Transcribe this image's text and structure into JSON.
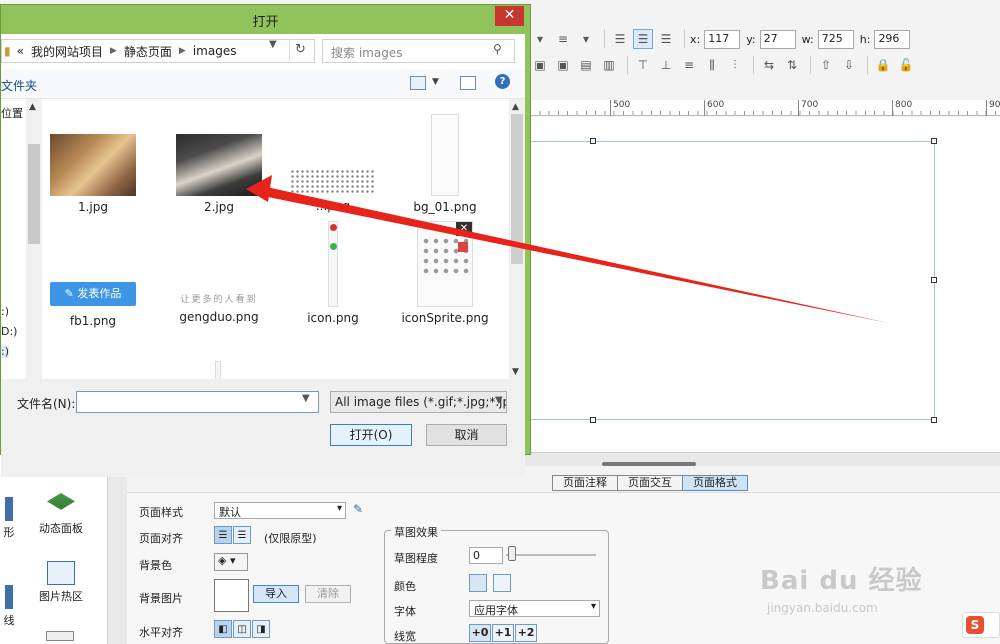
{
  "app": {
    "geometry": {
      "x_label": "x:",
      "x_value": "117",
      "y_label": "y:",
      "y_value": "27",
      "w_label": "w:",
      "w_value": "725",
      "h_label": "h:",
      "h_value": "296"
    },
    "ruler_ticks": [
      "500",
      "600",
      "700",
      "800",
      "90"
    ],
    "prop_tabs": [
      "页面注释",
      "页面交互",
      "页面格式"
    ],
    "prop_active_tab": "页面格式",
    "props": {
      "page_style_label": "页面样式",
      "page_style_value": "默认",
      "page_align_label": "页面对齐",
      "page_align_note": "(仅限原型)",
      "bg_color_label": "背景色",
      "bg_image_label": "背景图片",
      "import_label": "导入",
      "clear_label": "清除",
      "h_align_label": "水平对齐"
    },
    "sketch": {
      "title": "草图效果",
      "degree_label": "草图程度",
      "degree_value": "0",
      "color_label": "颜色",
      "font_label": "字体",
      "font_value": "应用字体",
      "line_width_label": "线宽",
      "line_widths": [
        "+0",
        "+1",
        "+2"
      ]
    },
    "widgets": {
      "top_label": "矩形",
      "items": [
        "形",
        "动态面板",
        "线",
        "图片热区"
      ]
    }
  },
  "dialog": {
    "title": "打开",
    "close_symbol": "✕",
    "breadcrumbs": [
      "«",
      "我的网站项目",
      "静态页面",
      "images"
    ],
    "search_placeholder": "搜索 images",
    "new_folder_label": "文件夹",
    "nav_items": [
      "位置",
      ":)",
      "D:)",
      ":)"
    ],
    "files": [
      {
        "name": "1.jpg",
        "kind": "photo-warm"
      },
      {
        "name": "2.jpg",
        "kind": "photo-dark"
      },
      {
        "name": "...png",
        "kind": "dots"
      },
      {
        "name": "bg_01.png",
        "kind": "tall-page"
      },
      {
        "name": "fb1.png",
        "kind": "button-blue"
      },
      {
        "name": "gengduo.png",
        "kind": "text-strip"
      },
      {
        "name": "icon.png",
        "kind": "icon-column"
      },
      {
        "name": "iconSprite.png",
        "kind": "sprite"
      }
    ],
    "fb1_button_text": "✎ 发表作品",
    "gengduo_text": "让更多的人看到",
    "filename_label": "文件名(N):",
    "filename_value": "",
    "filetype_value": "All image files (*.gif;*.jpg;*.jp",
    "open_button": "打开(O)",
    "cancel_button": "取消"
  },
  "watermark": {
    "brand": "Bai du 经验",
    "url": "jingyan.baidu.com"
  },
  "colors": {
    "dialog_frame": "#91c35c",
    "annotation_arrow": "#e8231b",
    "selection_border": "#a7c3dc",
    "close_button": "#c7362f"
  }
}
